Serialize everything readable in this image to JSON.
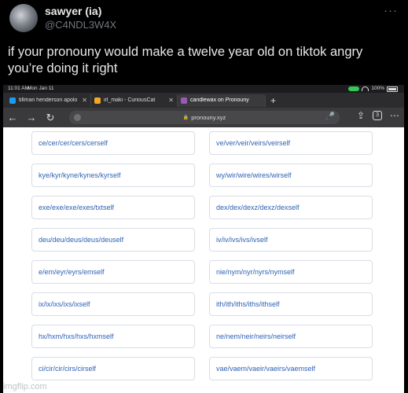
{
  "tweet": {
    "display_name": "sawyer (ia)",
    "handle": "@C4NDL3W4X",
    "text": "if your pronouny would make a twelve year old on tiktok angry you’re doing it right",
    "more_icon": "more-icon"
  },
  "status_bar": {
    "time": "11:01 AM",
    "date": "Mon Jan 11",
    "battery": "100%"
  },
  "tabs": [
    {
      "label": "tillman henderson apolo",
      "favicon_color": "#1d9bf0"
    },
    {
      "label": "irl_maki - CuriousCat",
      "favicon_color": "#f5a623"
    },
    {
      "label": "candlewax on Pronouny",
      "favicon_color": "#9b59b6"
    }
  ],
  "toolbar": {
    "back": "←",
    "forward": "→",
    "reload": "↻",
    "lock": "🔒",
    "url": "pronouny.xyz",
    "mic": "🎤",
    "share": "⇪",
    "tab_count": "3",
    "menu": "⋯"
  },
  "pronouns": [
    "ce/cer/cer/cers/cerself",
    "ve/ver/veir/veirs/veirself",
    "kye/kyr/kyne/kynes/kyrself",
    "wy/wir/wire/wires/wirself",
    "exe/exe/exe/exes/txtself",
    "dex/dex/dexz/dexz/dexself",
    "deu/deu/deus/deus/deuself",
    "iv/iv/ivs/ivs/ivself",
    "e/em/eyr/eyrs/emself",
    "nie/nym/nyr/nyrs/nymself",
    "ix/ix/ixs/ixs/ixself",
    "ith/ith/iths/iths/ithself",
    "hx/hxm/hxs/hxs/hxmself",
    "ne/nem/neir/neirs/neirself",
    "ci/cir/cir/cirs/cirself",
    "vae/vaem/vaeir/vaeirs/vaemself"
  ],
  "watermark": "imgflip.com"
}
